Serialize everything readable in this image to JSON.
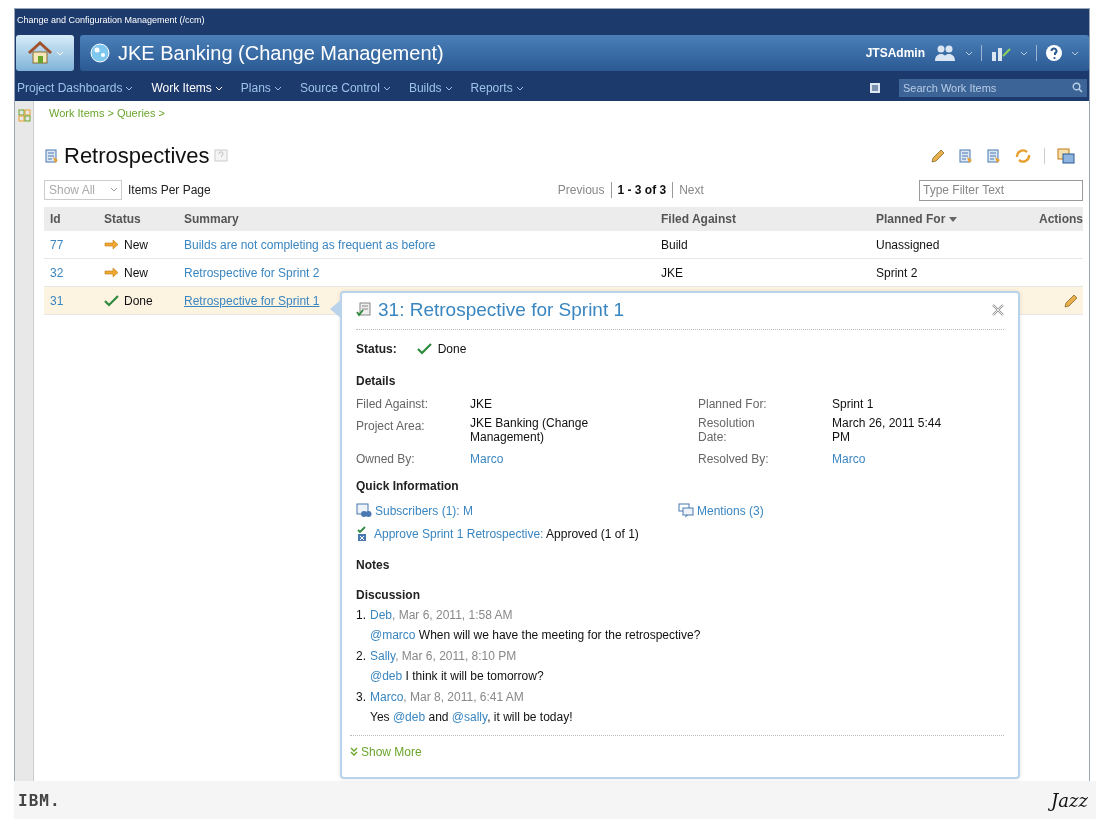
{
  "window": {
    "title": "Change and Configuration Management (/ccm)"
  },
  "banner": {
    "project": "JKE Banking (Change Management)",
    "user": "JTSAdmin"
  },
  "nav": {
    "items": [
      {
        "label": "Project Dashboards",
        "selected": false
      },
      {
        "label": "Work Items",
        "selected": true
      },
      {
        "label": "Plans",
        "selected": false
      },
      {
        "label": "Source Control",
        "selected": false
      },
      {
        "label": "Builds",
        "selected": false
      },
      {
        "label": "Reports",
        "selected": false
      }
    ],
    "search": {
      "placeholder": "Search Work Items"
    }
  },
  "breadcrumb": "Work Items > Queries >",
  "page": {
    "title": "Retrospectives",
    "page_size": {
      "placeholder": "Show All"
    },
    "page_size_label": "Items Per Page",
    "pager": {
      "previous": "Previous",
      "range": "1 - 3 of 3",
      "next": "Next"
    },
    "filter": {
      "placeholder": "Type Filter Text"
    }
  },
  "table": {
    "columns": [
      "Id",
      "Status",
      "Summary",
      "Filed Against",
      "Planned For",
      "Actions"
    ],
    "rows": [
      {
        "id": "77",
        "status": {
          "label": "New",
          "kind": "new"
        },
        "summary": "Builds are not completing as frequent as before",
        "filed_against": "Build",
        "planned_for": "Unassigned",
        "selected": false
      },
      {
        "id": "32",
        "status": {
          "label": "New",
          "kind": "new"
        },
        "summary": "Retrospective for Sprint 2",
        "filed_against": "JKE",
        "planned_for": "Sprint 2",
        "selected": false
      },
      {
        "id": "31",
        "status": {
          "label": "Done",
          "kind": "done"
        },
        "summary": "Retrospective for Sprint 1",
        "selected": true
      }
    ]
  },
  "popup": {
    "title": "31: Retrospective for Sprint 1",
    "status_label": "Status:",
    "status": {
      "label": "Done",
      "kind": "done"
    },
    "details_heading": "Details",
    "details": [
      {
        "label": "Filed Against:",
        "value": "JKE",
        "kind": "text"
      },
      {
        "label": "Planned For:",
        "value": "Sprint 1",
        "kind": "text"
      },
      {
        "label": "Project Area:",
        "value": "JKE Banking (Change Management)",
        "kind": "text"
      },
      {
        "label": "Resolution Date:",
        "value": "March 26, 2011 5:44 PM",
        "kind": "text"
      },
      {
        "label": "Owned By:",
        "value": "Marco",
        "kind": "link"
      },
      {
        "label": "Resolved By:",
        "value": "Marco",
        "kind": "link"
      }
    ],
    "quick_heading": "Quick Information",
    "subscribers": "Subscribers (1): M",
    "mentions": "Mentions (3)",
    "approval": {
      "link": "Approve Sprint 1 Retrospective:",
      "result": " Approved (1 of 1)"
    },
    "notes_heading": "Notes",
    "discussion_heading": "Discussion",
    "comments": [
      {
        "number": "1.",
        "author": "Deb",
        "meta": ", Mar 6, 2011, 1:58 AM",
        "body": [
          {
            "kind": "mention",
            "text": "@marco"
          },
          {
            "kind": "plain",
            "text": " When will we have the meeting for the retrospective?"
          }
        ]
      },
      {
        "number": "2.",
        "author": "Sally",
        "meta": ", Mar 6, 2011, 8:10 PM",
        "body": [
          {
            "kind": "mention",
            "text": "@deb"
          },
          {
            "kind": "plain",
            "text": " I think it will be tomorrow?"
          }
        ]
      },
      {
        "number": "3.",
        "author": "Marco",
        "meta": ", Mar 8, 2011, 6:41 AM",
        "body": [
          {
            "kind": "plain",
            "text": "Yes "
          },
          {
            "kind": "mention",
            "text": "@deb"
          },
          {
            "kind": "plain",
            "text": " and "
          },
          {
            "kind": "mention",
            "text": "@sally"
          },
          {
            "kind": "plain",
            "text": ", it will be today!"
          }
        ]
      }
    ],
    "show_more": "Show More"
  },
  "footer": {
    "left": "IBM.",
    "right": "Jazz"
  }
}
